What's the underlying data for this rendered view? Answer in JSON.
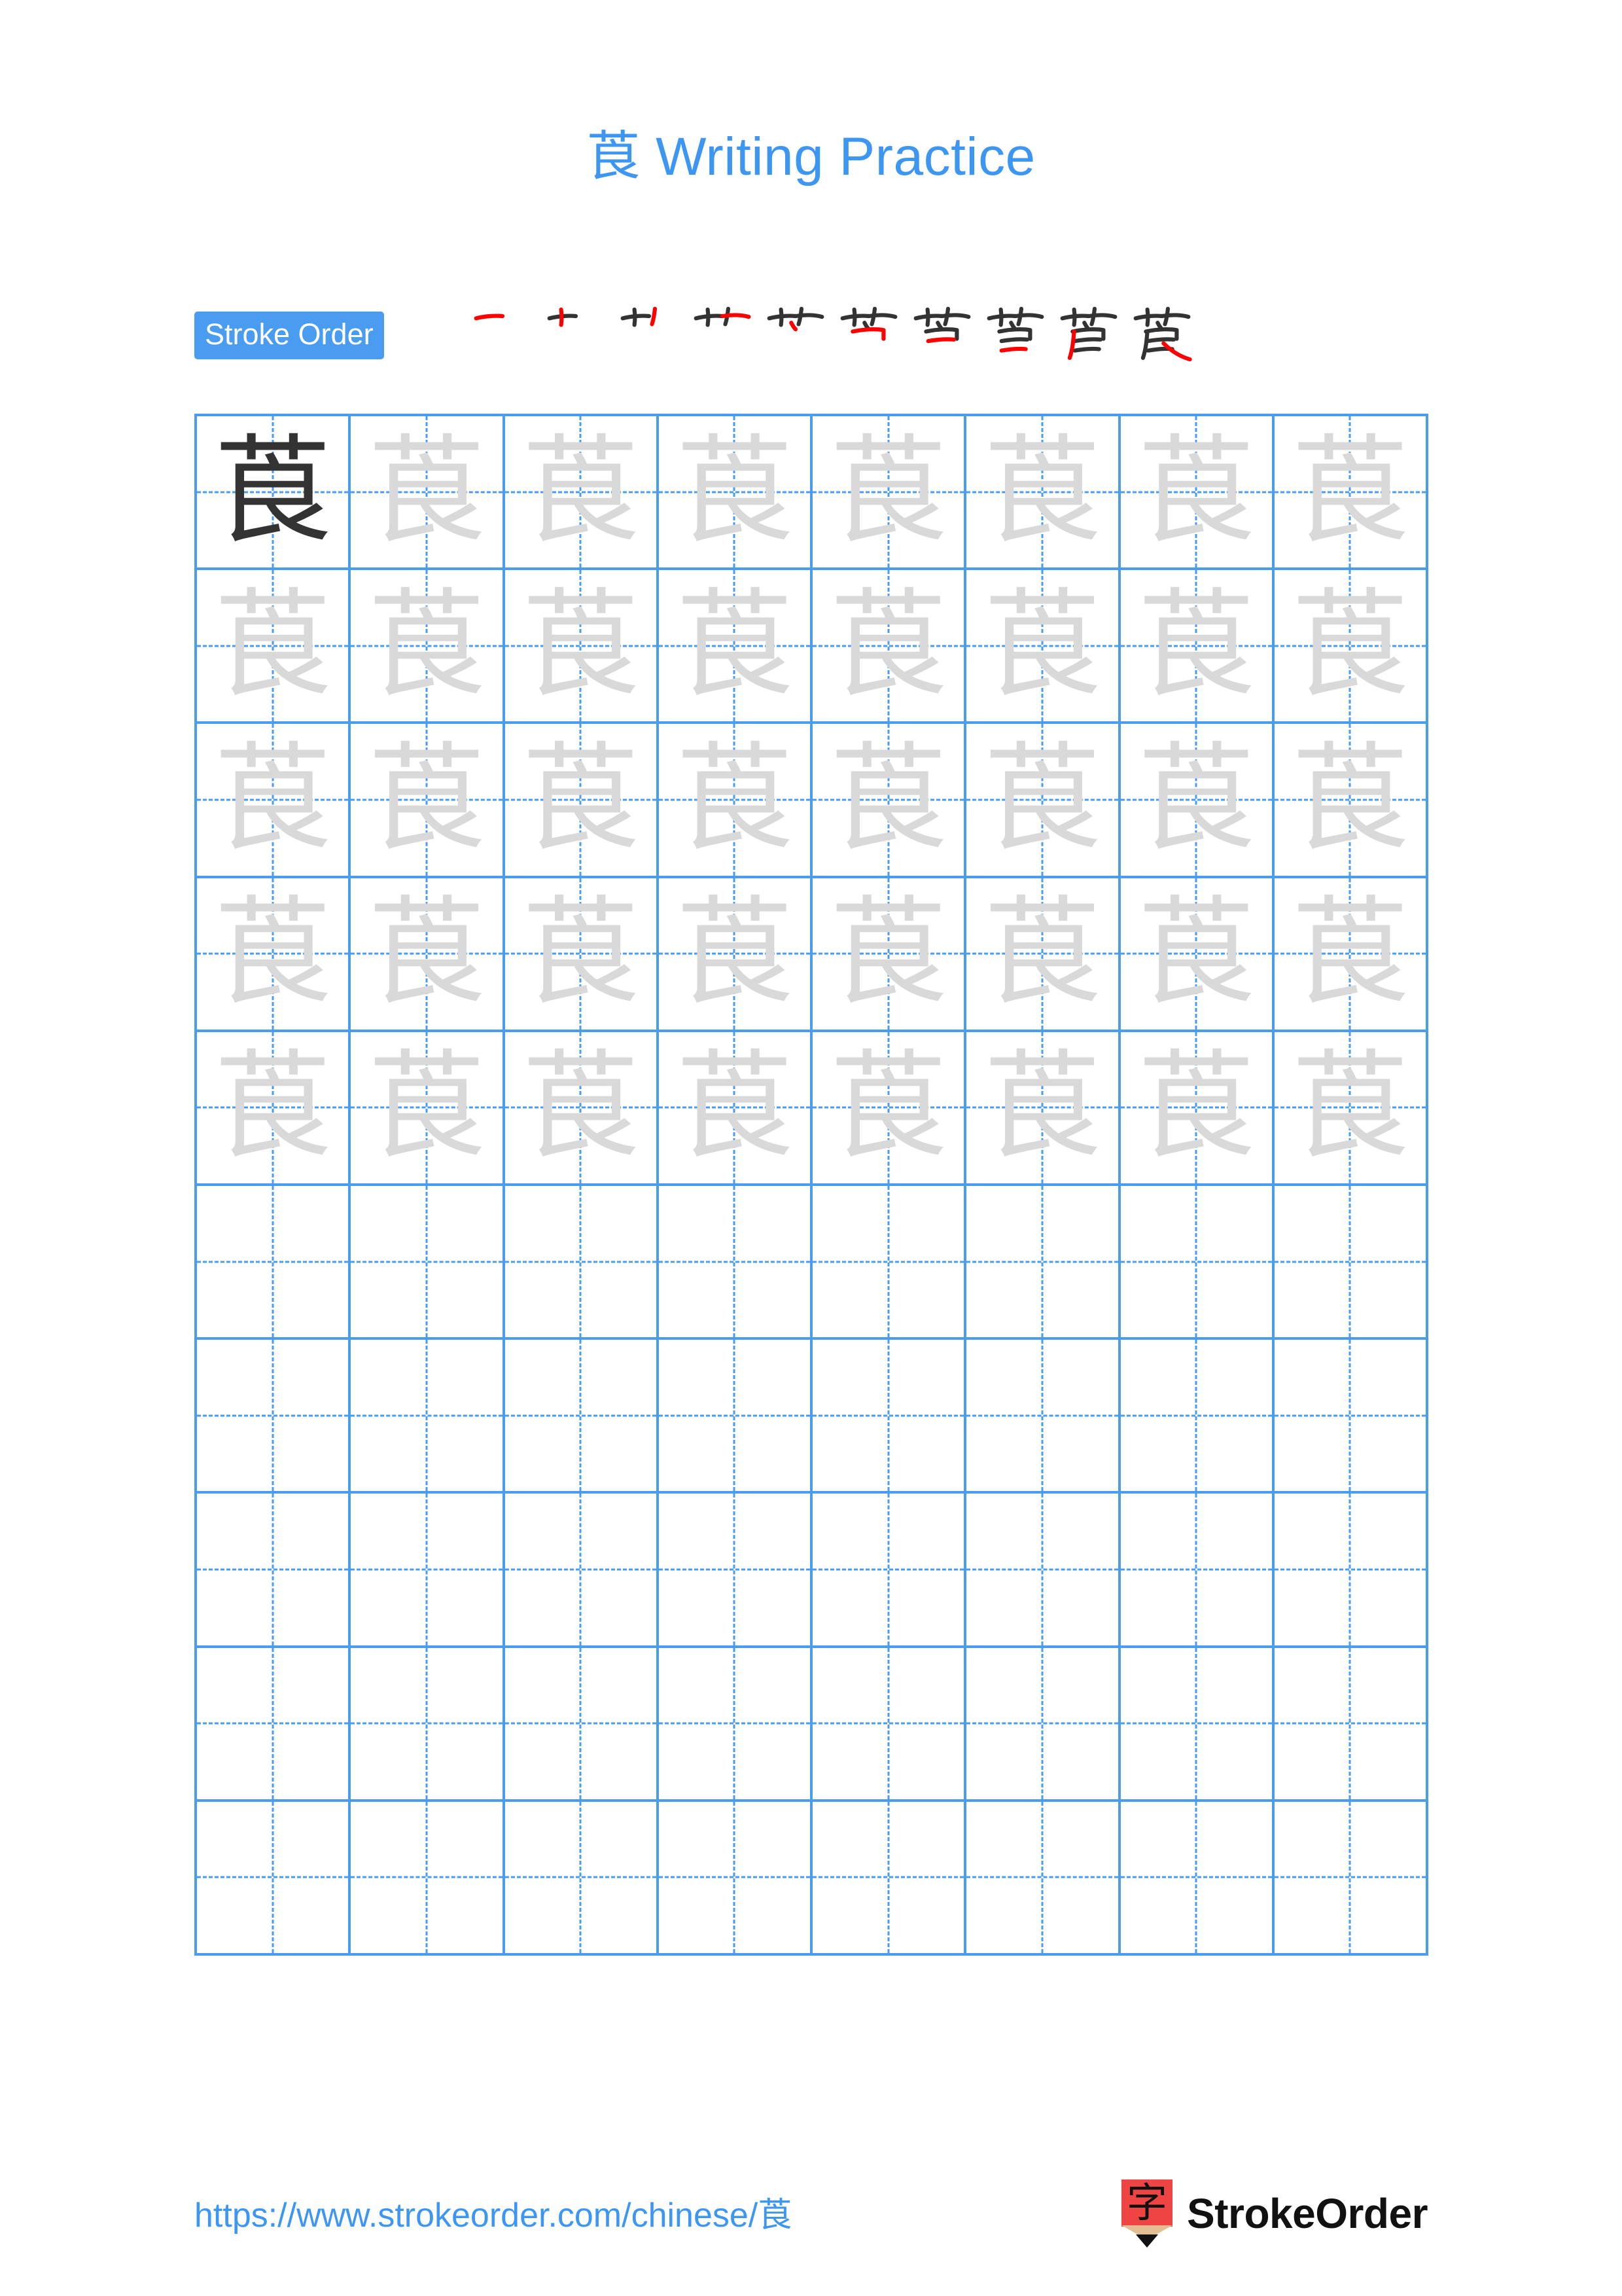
{
  "character": "莨",
  "title": "莨 Writing Practice",
  "colors": {
    "accent_blue": "#3d97f2",
    "badge_blue": "#4a9cf0",
    "grid_line": "#4a9cf0",
    "model_char": "#333333",
    "trace_char": "#d9d9d9",
    "stroke_new": "#ff0000",
    "stroke_done": "#333333",
    "logo_red": "#ef4444",
    "logo_wood": "#e3bd93"
  },
  "stroke_order": {
    "badge_label": "Stroke Order",
    "total_strokes": 10,
    "steps": [
      {
        "index": 1,
        "glyph": "一",
        "new_stroke": "heng (horizontal)"
      },
      {
        "index": 2,
        "glyph": "十",
        "new_stroke": "shu (vertical)"
      },
      {
        "index": 3,
        "glyph": "艹",
        "new_stroke": "shu (vertical)"
      },
      {
        "index": 4,
        "glyph": "艹",
        "new_stroke": "heng (horizontal)"
      },
      {
        "index": 5,
        "glyph": "艼",
        "new_stroke": "pie (left falling)"
      },
      {
        "index": 6,
        "glyph": "艿",
        "new_stroke": "heng (horizontal)"
      },
      {
        "index": 7,
        "glyph": "苣",
        "new_stroke": "heng (horizontal)"
      },
      {
        "index": 8,
        "glyph": "苣",
        "new_stroke": "shu (vertical)"
      },
      {
        "index": 9,
        "glyph": "莨",
        "new_stroke": "pie (left falling)"
      },
      {
        "index": 10,
        "glyph": "莨",
        "new_stroke": "na (right falling)"
      }
    ]
  },
  "practice_grid": {
    "columns": 8,
    "rows": 10,
    "cells": [
      [
        "model",
        "trace",
        "trace",
        "trace",
        "trace",
        "trace",
        "trace",
        "trace"
      ],
      [
        "trace",
        "trace",
        "trace",
        "trace",
        "trace",
        "trace",
        "trace",
        "trace"
      ],
      [
        "trace",
        "trace",
        "trace",
        "trace",
        "trace",
        "trace",
        "trace",
        "trace"
      ],
      [
        "trace",
        "trace",
        "trace",
        "trace",
        "trace",
        "trace",
        "trace",
        "trace"
      ],
      [
        "trace",
        "trace",
        "trace",
        "trace",
        "trace",
        "trace",
        "trace",
        "trace"
      ],
      [
        "blank",
        "blank",
        "blank",
        "blank",
        "blank",
        "blank",
        "blank",
        "blank"
      ],
      [
        "blank",
        "blank",
        "blank",
        "blank",
        "blank",
        "blank",
        "blank",
        "blank"
      ],
      [
        "blank",
        "blank",
        "blank",
        "blank",
        "blank",
        "blank",
        "blank",
        "blank"
      ],
      [
        "blank",
        "blank",
        "blank",
        "blank",
        "blank",
        "blank",
        "blank",
        "blank"
      ],
      [
        "blank",
        "blank",
        "blank",
        "blank",
        "blank",
        "blank",
        "blank",
        "blank"
      ]
    ]
  },
  "footer": {
    "url": "https://www.strokeorder.com/chinese/莨",
    "brand_name": "StrokeOrder",
    "logo_glyph": "字"
  }
}
